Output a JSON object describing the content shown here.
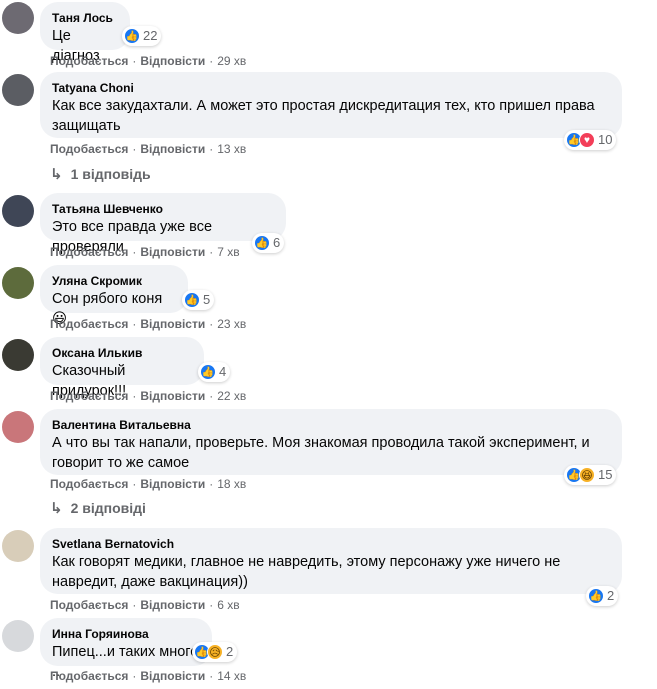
{
  "actions": {
    "like": "Подобається",
    "reply": "Відповісти",
    "dot": "·"
  },
  "comments": [
    {
      "author": "Таня Лось",
      "text": "Це діагноз",
      "reactions_count": "22",
      "time": "29 хв",
      "avatar_color": "#6d6a72"
    },
    {
      "author": "Tatyana Choni",
      "text": "Как все закудахтали. А может это простая дискредитация тех, кто пришел права защищать",
      "reactions_count": "10",
      "time": "13 хв",
      "replies": "1 відповідь",
      "avatar_color": "#5b5d63"
    },
    {
      "author": "Татьяна Шевченко",
      "text": "Это все правда уже все проверяли",
      "reactions_count": "6",
      "time": "7 хв",
      "avatar_color": "#3f4656"
    },
    {
      "author": "Уляна Скромик",
      "text": "Сон рябого коня",
      "emoji": "😃",
      "reactions_count": "5",
      "time": "23 хв",
      "avatar_color": "#5d6b3c"
    },
    {
      "author": "Оксана Илькив",
      "text": "Сказочный придурок!!!",
      "reactions_count": "4",
      "time": "22 хв",
      "avatar_color": "#3a3a33"
    },
    {
      "author": "Валентина Витальевна",
      "text": "А что вы так напали, проверьте. Моя знакомая проводила такой эксперимент, и говорит то же самое",
      "reactions_count": "15",
      "time": "18 хв",
      "replies": "2 відповіді",
      "avatar_color": "#c9767a"
    },
    {
      "author": "Svetlana Bernatovich",
      "text": "Как говорят медики, главное не навредить, этому персонажу уже ничего не навредит, даже вакцинация))",
      "reactions_count": "2",
      "time": "6 хв",
      "avatar_color": "#d8cdb9"
    },
    {
      "author": "Инна Горяинова",
      "text": "Пипец...и таких много ..",
      "reactions_count": "2",
      "time": "14 хв",
      "avatar_color": "#d7d9dc"
    }
  ],
  "colors": {
    "bubble": "#f0f2f5",
    "like_blue": "#1877f2",
    "love_red": "#f33e58",
    "haha_yellow": "#f7b125",
    "meta_gray": "#65676b"
  }
}
